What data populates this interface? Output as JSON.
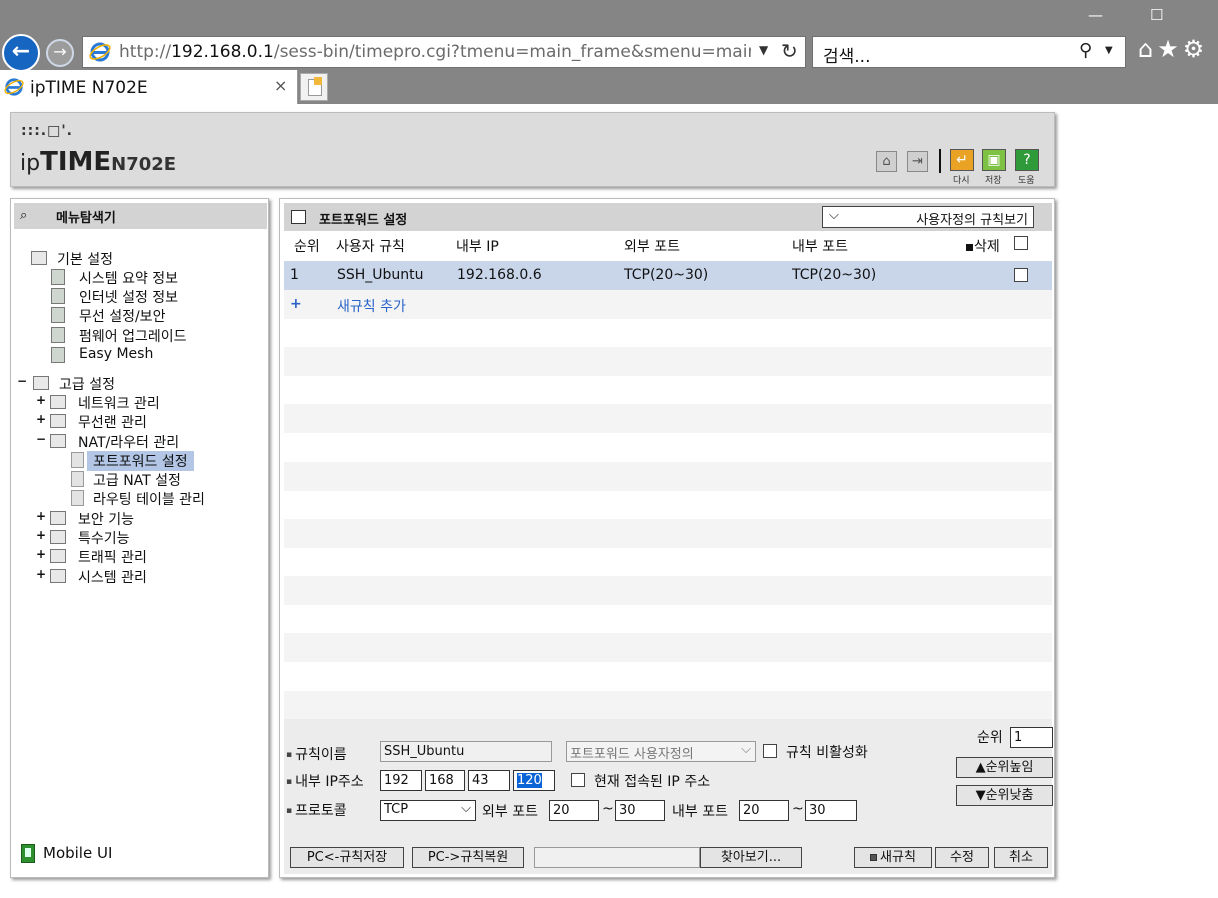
{
  "browser": {
    "url_prefix": "http://",
    "url_host": "192.168.0.1",
    "url_path": "/sess-bin/timepro.cgi?tmenu=main_frame&smenu=main_fra",
    "search_placeholder": "검색...",
    "tab_title": "ipTIME N702E",
    "tab_close": "×"
  },
  "header": {
    "logo_dots": ":::.□'.",
    "logo_ip": "ip",
    "logo_time": "TIME",
    "model": "N702E",
    "btn_reload_label": "다시",
    "btn_save_label": "저장",
    "btn_help_label": "도움"
  },
  "sidebar": {
    "title": "메뉴탐색기",
    "items": [
      {
        "label": "기본 설정"
      },
      {
        "label": "시스템 요약 정보"
      },
      {
        "label": "인터넷 설정 정보"
      },
      {
        "label": "무선 설정/보안"
      },
      {
        "label": "펌웨어 업그레이드"
      },
      {
        "label": "Easy Mesh"
      },
      {
        "label": "고급 설정"
      },
      {
        "label": "네트워크 관리"
      },
      {
        "label": "무선랜 관리"
      },
      {
        "label": "NAT/라우터 관리"
      },
      {
        "label": "포트포워드 설정"
      },
      {
        "label": "고급 NAT 설정"
      },
      {
        "label": "라우팅 테이블 관리"
      },
      {
        "label": "보안 기능"
      },
      {
        "label": "특수기능"
      },
      {
        "label": "트래픽 관리"
      },
      {
        "label": "시스템 관리"
      }
    ],
    "toggle_minus": "−",
    "toggle_plus": "+",
    "mobile_ui": "Mobile UI"
  },
  "main": {
    "title": "포트포워드 설정",
    "view_select": "사용자정의 규칙보기",
    "columns": {
      "order": "순위",
      "rule": "사용자 규칙",
      "internal_ip": "내부 IP",
      "external_port": "외부 포트",
      "internal_port": "내부 포트",
      "delete": "삭제"
    },
    "rules": [
      {
        "order": "1",
        "rule": "SSH_Ubuntu",
        "internal_ip": "192.168.0.6",
        "external_port": "TCP(20~30)",
        "internal_port": "TCP(20~30)"
      }
    ],
    "add_rule_plus": "+",
    "add_rule": "새규칙 추가"
  },
  "form": {
    "rule_name_label": "규칙이름",
    "rule_name_value": "SSH_Ubuntu",
    "preset_select": "포트포워드 사용자정의",
    "disable_rule_label": "규칙 비활성화",
    "order_label": "순위",
    "order_value": "1",
    "order_up": "▲순위높임",
    "order_down": "▼순위낮춤",
    "internal_ip_label": "내부 IP주소",
    "ip1": "192",
    "ip2": "168",
    "ip3": "43",
    "ip4": "120",
    "current_ip_label": "현재 접속된 IP 주소",
    "protocol_label": "프로토콜",
    "protocol_value": "TCP",
    "external_port_label": "외부 포트",
    "ext_port_from": "20",
    "ext_port_to": "30",
    "internal_port_label": "내부 포트",
    "int_port_from": "20",
    "int_port_to": "30",
    "tilde": "~",
    "btn_pc_save": "PC<-규칙저장",
    "btn_pc_restore": "PC->규칙복원",
    "btn_browse": "찾아보기...",
    "btn_new_rule": "새규칙",
    "btn_modify": "수정",
    "btn_cancel": "취소"
  },
  "colors": {
    "chrome": "#858585",
    "selected_row": "#c9d6ea",
    "sidebar_selected": "#b3c6e6",
    "accent_blue": "#1665c1"
  }
}
